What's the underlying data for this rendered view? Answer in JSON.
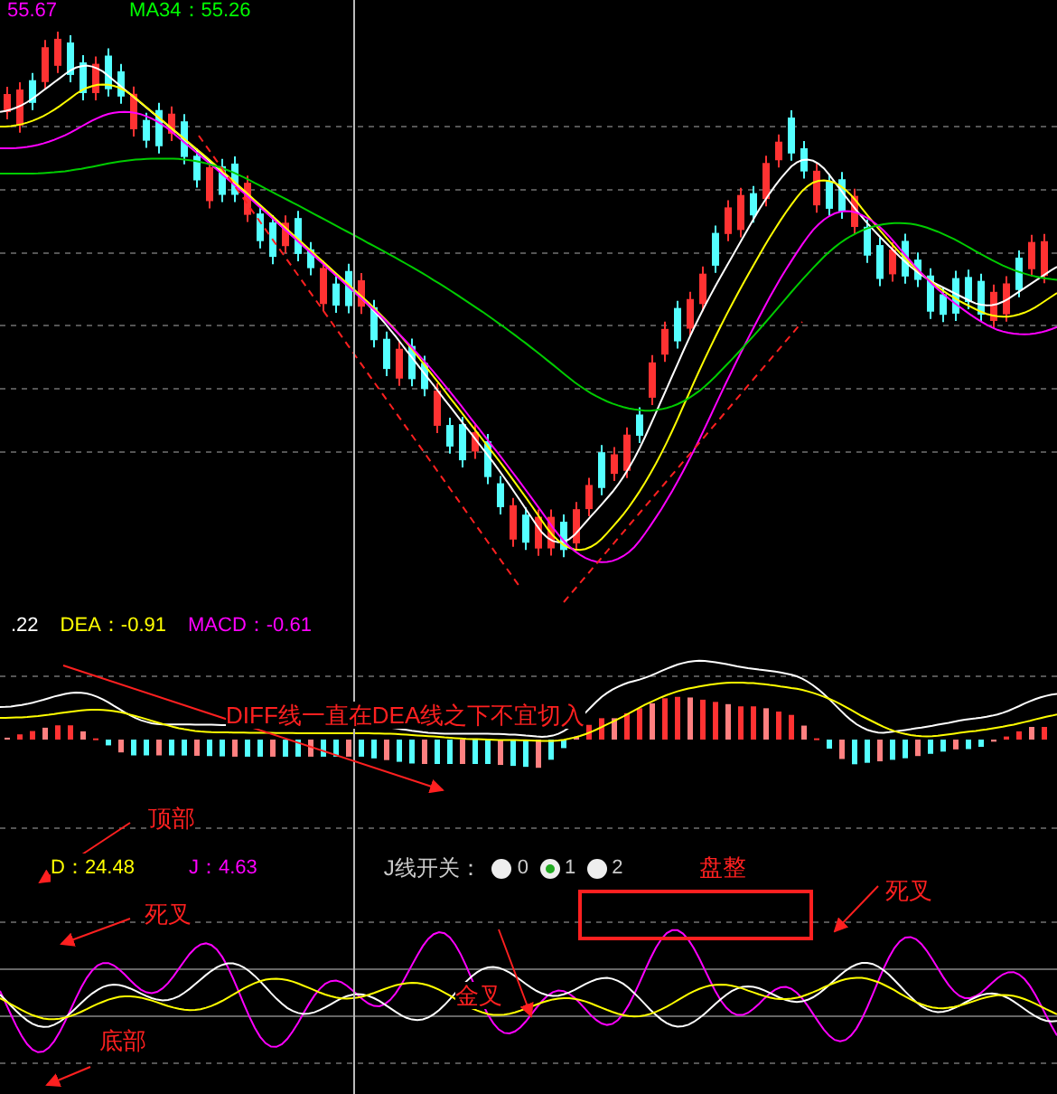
{
  "price_panel": {
    "legends": [
      {
        "text": "55.67",
        "color": "#ff00ff"
      },
      {
        "text": "MA34：55.26",
        "color": "#00ff00"
      }
    ]
  },
  "macd_panel": {
    "legends": [
      {
        "text": ".22",
        "color": "#ffffff"
      },
      {
        "text": "DEA：-0.91",
        "color": "#ffff00"
      },
      {
        "text": "MACD：-0.61",
        "color": "#ff00ff"
      }
    ],
    "note": "DIFF线一直在DEA线之下不宜切入"
  },
  "kdj_panel": {
    "legends": [
      {
        "text": "D：24.48",
        "color": "#ffff00"
      },
      {
        "text": "J：4.63",
        "color": "#ff00ff"
      }
    ],
    "switch_label": "J线开关：",
    "radios": [
      {
        "label": "0",
        "selected": false
      },
      {
        "label": "1",
        "selected": true
      },
      {
        "label": "2",
        "selected": false
      }
    ]
  },
  "annotations": [
    {
      "text": "顶部"
    },
    {
      "text": "死叉"
    },
    {
      "text": "底部"
    },
    {
      "text": "金叉"
    },
    {
      "text": "盘整"
    },
    {
      "text": "死叉"
    }
  ]
}
